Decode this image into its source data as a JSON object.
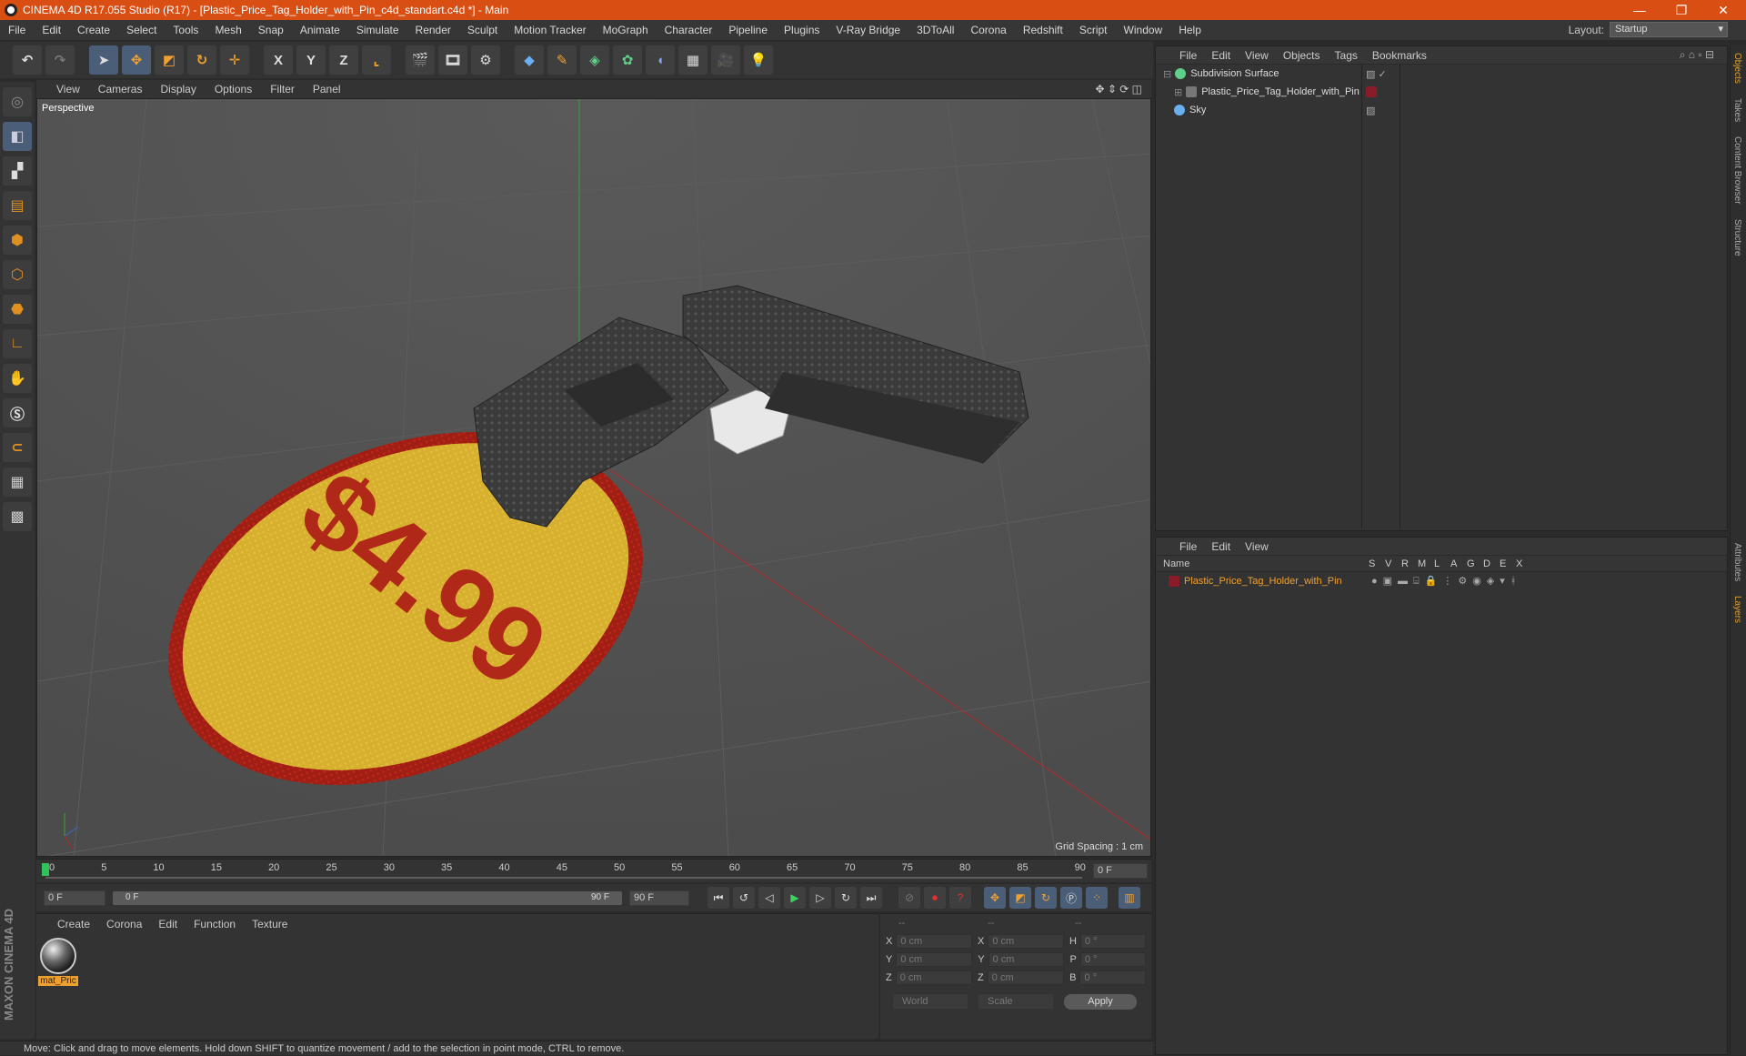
{
  "window": {
    "title": "CINEMA 4D R17.055 Studio (R17) - [Plastic_Price_Tag_Holder_with_Pin_c4d_standart.c4d *] - Main",
    "min": "—",
    "max": "❐",
    "close": "✕"
  },
  "menu": [
    "File",
    "Edit",
    "Create",
    "Select",
    "Tools",
    "Mesh",
    "Snap",
    "Animate",
    "Simulate",
    "Render",
    "Sculpt",
    "Motion Tracker",
    "MoGraph",
    "Character",
    "Pipeline",
    "Plugins",
    "V-Ray Bridge",
    "3DToAll",
    "Corona",
    "Redshift",
    "Script",
    "Window",
    "Help"
  ],
  "layout": {
    "label": "Layout:",
    "value": "Startup"
  },
  "toolbar": {
    "x": "X",
    "y": "Y",
    "z": "Z"
  },
  "viewport": {
    "menu": [
      "View",
      "Cameras",
      "Display",
      "Options",
      "Filter",
      "Panel"
    ],
    "label": "Perspective",
    "grid": "Grid Spacing : 1 cm",
    "price": "$4.99"
  },
  "timeline": {
    "ticks": [
      "0",
      "5",
      "10",
      "15",
      "20",
      "25",
      "30",
      "35",
      "40",
      "45",
      "50",
      "55",
      "60",
      "65",
      "70",
      "75",
      "80",
      "85",
      "90"
    ],
    "current": "0 F",
    "start": "0 F",
    "range_start": "0 F",
    "range_end": "90 F",
    "end": "90 F"
  },
  "materials": {
    "menu": [
      "Create",
      "Corona",
      "Edit",
      "Function",
      "Texture"
    ],
    "item": "mat_Pric"
  },
  "coords": {
    "head": [
      "--",
      "--",
      "--"
    ],
    "rows": [
      {
        "a": "X",
        "av": "0 cm",
        "b": "X",
        "bv": "0 cm",
        "c": "H",
        "cv": "0 °"
      },
      {
        "a": "Y",
        "av": "0 cm",
        "b": "Y",
        "bv": "0 cm",
        "c": "P",
        "cv": "0 °"
      },
      {
        "a": "Z",
        "av": "0 cm",
        "b": "Z",
        "bv": "0 cm",
        "c": "B",
        "cv": "0 °"
      }
    ],
    "world": "World",
    "scale": "Scale",
    "apply": "Apply"
  },
  "status": "Move: Click and drag to move elements. Hold down SHIFT to quantize movement / add to the selection in point mode, CTRL to remove.",
  "objects": {
    "menu": [
      "File",
      "Edit",
      "View",
      "Objects",
      "Tags",
      "Bookmarks"
    ],
    "items": [
      "Subdivision Surface",
      "Plastic_Price_Tag_Holder_with_Pin",
      "Sky"
    ]
  },
  "layers": {
    "menu": [
      "File",
      "Edit",
      "View"
    ],
    "cols": [
      "Name",
      "S",
      "V",
      "R",
      "M",
      "L",
      "A",
      "G",
      "D",
      "E",
      "X"
    ],
    "item": "Plastic_Price_Tag_Holder_with_Pin"
  },
  "sidetabs": [
    "Objects",
    "Takes",
    "Content Browser",
    "Structure",
    "Attributes",
    "Layers"
  ],
  "brand": "MAXON CINEMA 4D"
}
